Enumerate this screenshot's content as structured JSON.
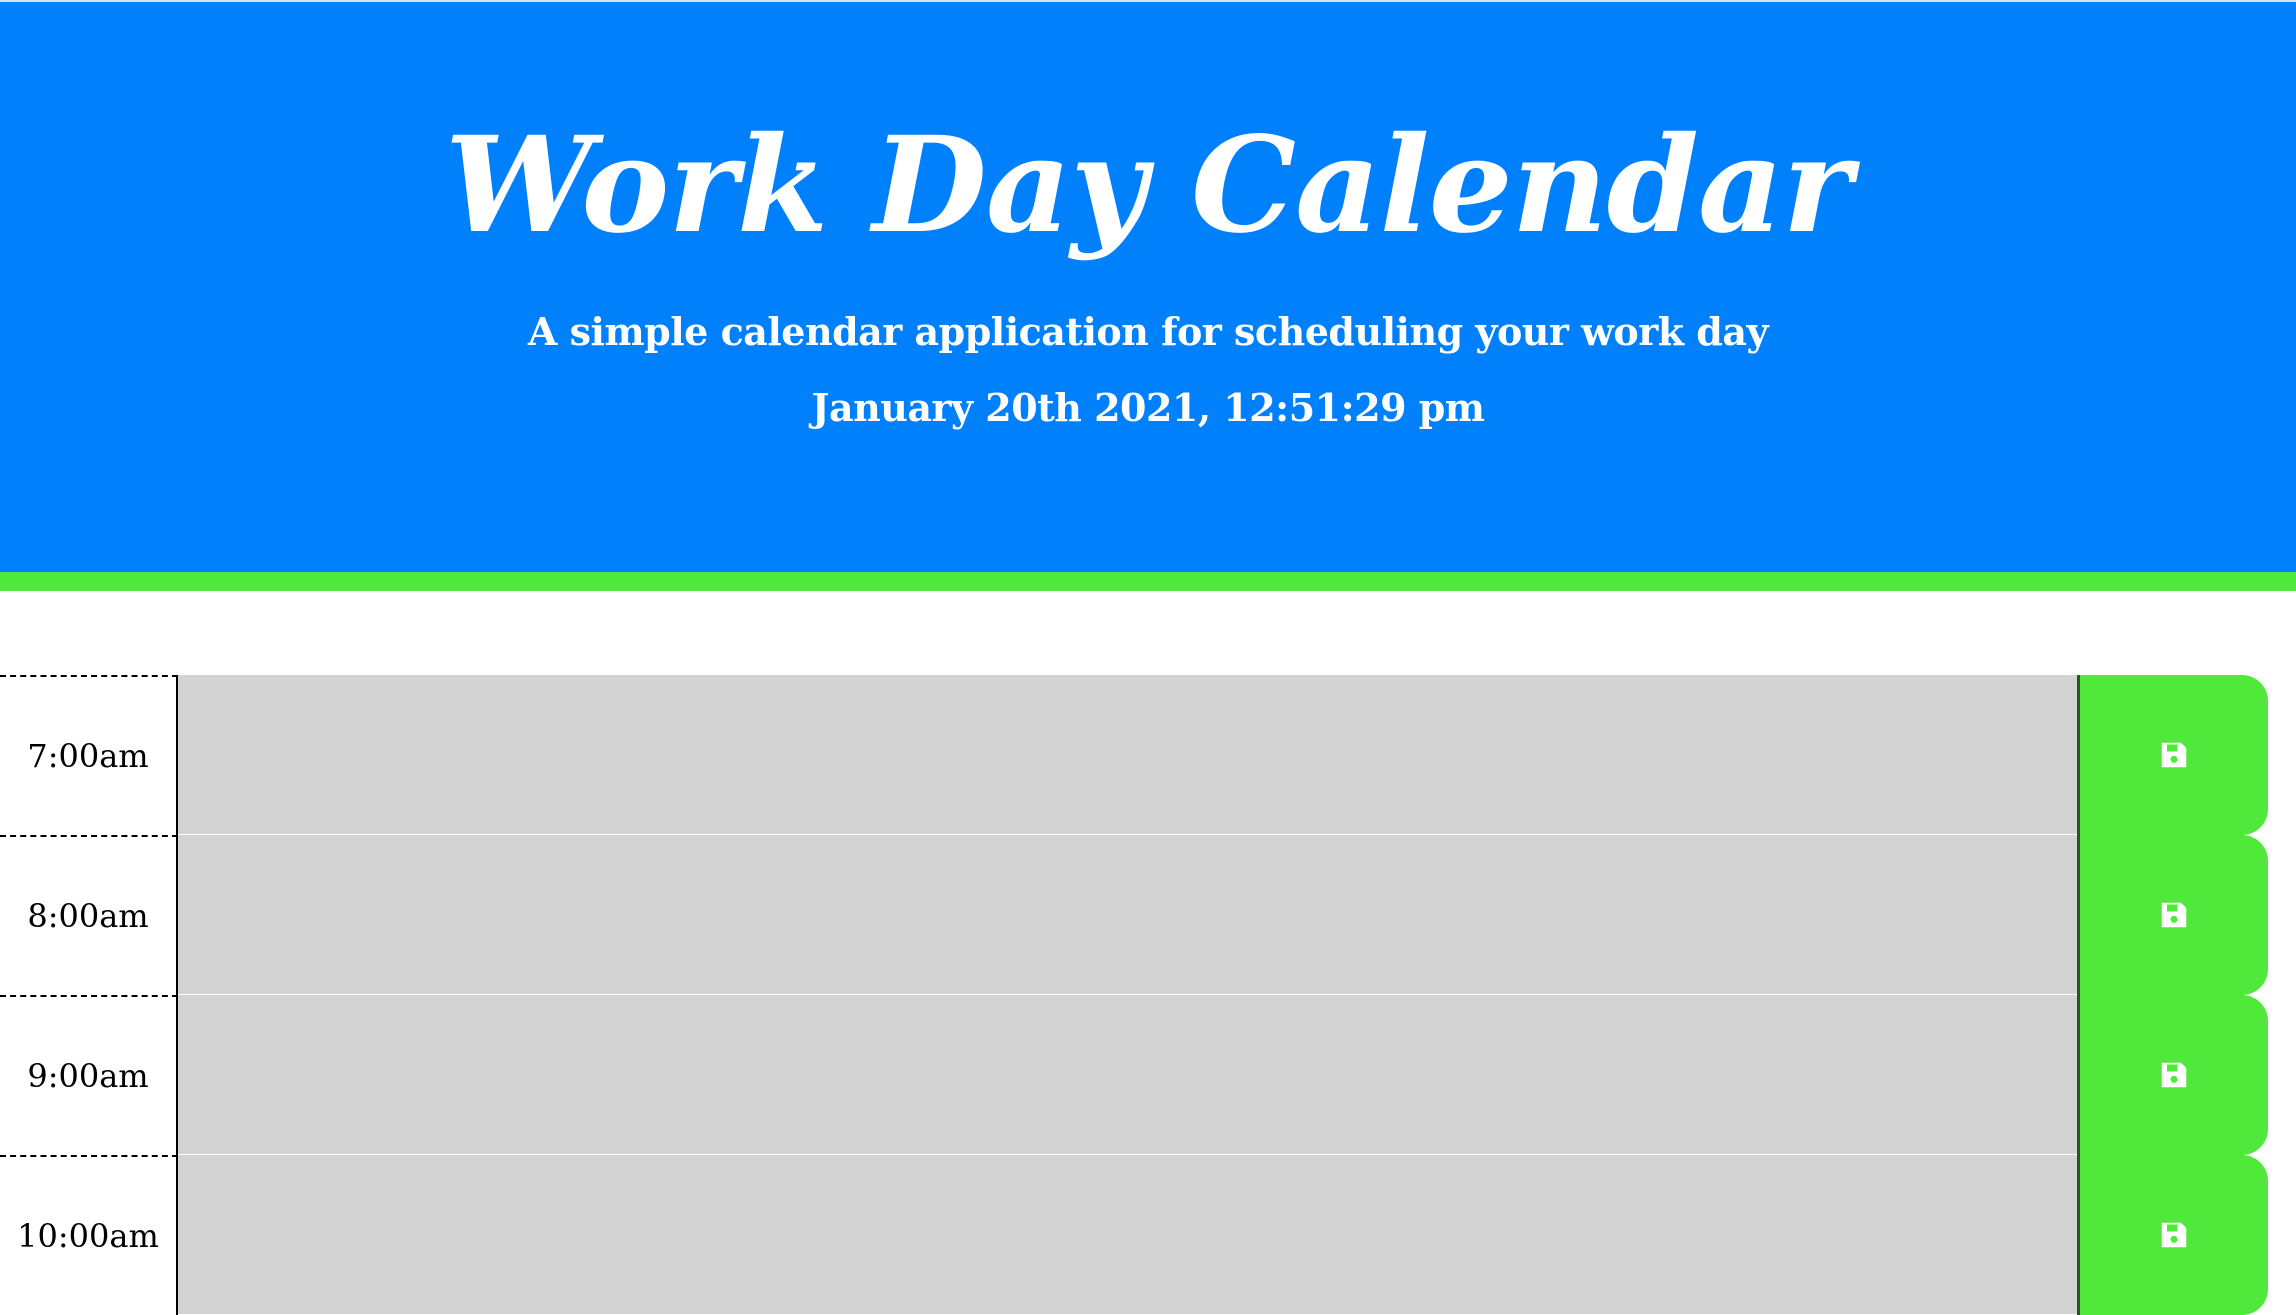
{
  "header": {
    "title": "Work Day Calendar",
    "lead": "A simple calendar application for scheduling your work day",
    "current_day": "January 20th 2021, 12:51:29 pm"
  },
  "colors": {
    "header_bg": "#0080fb",
    "accent_green": "#50e83b",
    "past_block": "#d3d3d3"
  },
  "timeblocks": [
    {
      "hour": "7:00am",
      "text": "",
      "save_icon": "save-icon"
    },
    {
      "hour": "8:00am",
      "text": "",
      "save_icon": "save-icon"
    },
    {
      "hour": "9:00am",
      "text": "",
      "save_icon": "save-icon"
    },
    {
      "hour": "10:00am",
      "text": "",
      "save_icon": "save-icon"
    }
  ]
}
